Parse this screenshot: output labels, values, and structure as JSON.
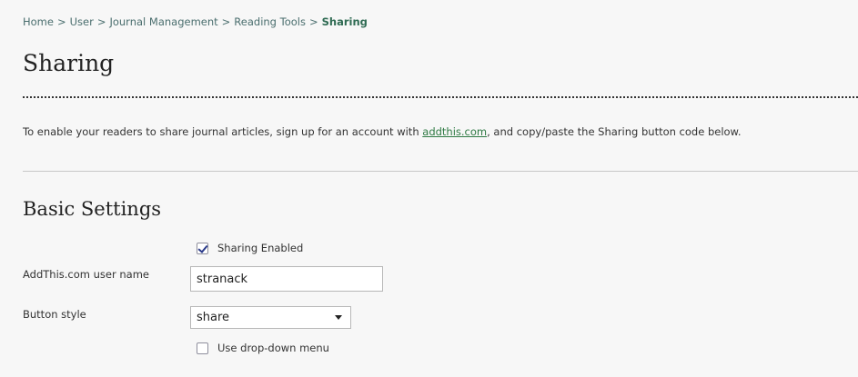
{
  "breadcrumb": {
    "separator": ">",
    "items": [
      {
        "label": "Home"
      },
      {
        "label": "User"
      },
      {
        "label": "Journal Management"
      },
      {
        "label": "Reading Tools"
      }
    ],
    "current": "Sharing"
  },
  "page": {
    "title": "Sharing"
  },
  "intro": {
    "before_link": "To enable your readers to share journal articles, sign up for an account with ",
    "link_text": "addthis.com",
    "after_link": ", and copy/paste the Sharing button code below."
  },
  "basic_settings": {
    "title": "Basic Settings",
    "sharing_enabled": {
      "label": "Sharing Enabled",
      "checked": true
    },
    "username": {
      "label": "AddThis.com user name",
      "value": "stranack"
    },
    "button_style": {
      "label": "Button style",
      "selected": "share"
    },
    "use_dropdown": {
      "label": "Use drop-down menu",
      "checked": false
    }
  },
  "colors": {
    "background": "#f7f7f7",
    "breadcrumb": "#4a6e6e",
    "breadcrumb_current": "#2f6b53",
    "link": "#2f7a44"
  }
}
